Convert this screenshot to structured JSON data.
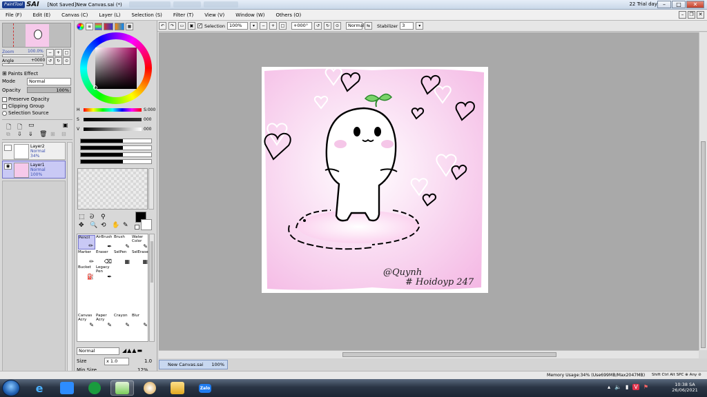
{
  "app": {
    "logo_brand": "PaintTool",
    "logo_sai": "SAI",
    "window_title": "[Not Saved]New Canvas.sai (*)",
    "trial": "22 Trial day"
  },
  "menu": [
    "File (F)",
    "Edit (E)",
    "Canvas (C)",
    "Layer (L)",
    "Selection (S)",
    "Filter (T)",
    "View (V)",
    "Window (W)",
    "Others (O)"
  ],
  "navigator": {
    "zoom_label": "Zoom",
    "zoom_value": "100.0%",
    "angle_label": "Angle",
    "angle_value": "+0000"
  },
  "layer_props": {
    "paint_effect": "Paints Effect",
    "mode_label": "Mode",
    "mode_value": "Normal",
    "opacity_label": "Opacity",
    "opacity_value": "100%",
    "preserve_opacity": "Preserve Opacity",
    "clipping_group": "Clipping Group",
    "selection_source": "Selection Source"
  },
  "layers": [
    {
      "name": "Layer2",
      "mode": "Normal",
      "opacity": "34%",
      "selected": false
    },
    {
      "name": "Layer1",
      "mode": "Normal",
      "opacity": "100%",
      "selected": true
    }
  ],
  "color": {
    "h_label": "H",
    "h_value": "S:000",
    "s_label": "S",
    "s_value": "000",
    "v_label": "V",
    "v_value": "000",
    "primary": "#000000",
    "secondary": "#ffffff"
  },
  "brushes": [
    {
      "name": "Pencil",
      "selected": true
    },
    {
      "name": "AirBrush",
      "selected": false
    },
    {
      "name": "Brush",
      "selected": false
    },
    {
      "name": "Water Color",
      "selected": false
    },
    {
      "name": "Marker",
      "selected": false
    },
    {
      "name": "Eraser",
      "selected": false
    },
    {
      "name": "SelPen",
      "selected": false
    },
    {
      "name": "SelErase",
      "selected": false
    },
    {
      "name": "Bucket",
      "selected": false
    },
    {
      "name": "Legacy Pen",
      "selected": false
    },
    {
      "name": "",
      "selected": false
    },
    {
      "name": "",
      "selected": false
    },
    {
      "name": "Canvas Acry",
      "selected": false
    },
    {
      "name": "Paper Acry",
      "selected": false
    },
    {
      "name": "Crayon",
      "selected": false
    },
    {
      "name": "Blur",
      "selected": false
    }
  ],
  "brush_settings": {
    "mode_value": "Normal",
    "size_label": "Size",
    "size_mult": "x 1.0",
    "size_value": "1.0",
    "minsize_label": "Min Size",
    "minsize_value": "12%"
  },
  "toolbar2": {
    "selection_label": "Selection",
    "zoom": "100%",
    "angle": "+000°",
    "mode": "Normal",
    "stabilizer_label": "Stabilizer",
    "stabilizer_value": "3"
  },
  "artwork": {
    "signature1": "@Quynh",
    "signature2": "# Hoidoyp 247"
  },
  "doc_tab": {
    "name": "New Canvas.sai",
    "zoom": "100%"
  },
  "status": {
    "memory": "Memory Usage:34% (Use699MB/Max2047MB)",
    "keys": "Shift Ctrl Alt SPC ⊕ Any ⊘"
  },
  "taskbar": {
    "clock_time": "10:38 SA",
    "clock_date": "26/06/2021",
    "apps": [
      "start-button",
      "internet-explorer",
      "zoom-meetings",
      "coccoc-browser",
      "paint-tool-sai",
      "paint",
      "file-explorer",
      "zalo"
    ],
    "zalo_label": "Zalo"
  }
}
